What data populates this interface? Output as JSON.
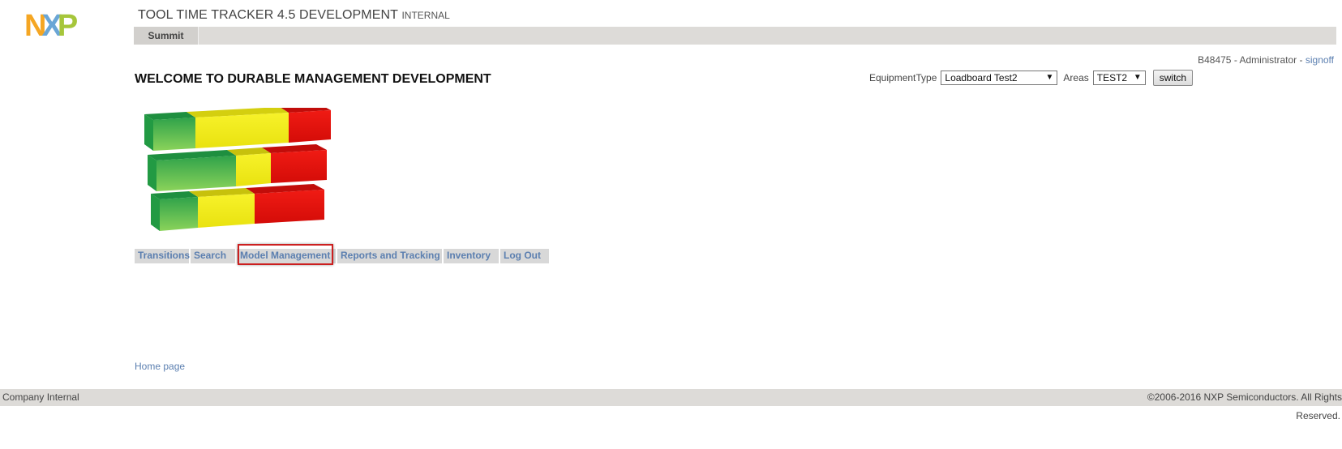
{
  "brand": {
    "logo_letters": [
      "N",
      "X",
      "P"
    ],
    "colors": {
      "n": "#f5a623",
      "x": "#6aa6d6",
      "p": "#a6c63b"
    }
  },
  "header": {
    "title": "TOOL TIME TRACKER 4.5 DEVELOPMENT",
    "title_suffix": "INTERNAL",
    "tabs": [
      {
        "label": "Summit"
      }
    ]
  },
  "user": {
    "info": "B48475 - Administrator -",
    "signoff_label": "signoff"
  },
  "welcome": "WELCOME TO DURABLE MANAGEMENT DEVELOPMENT",
  "equipment": {
    "type_label": "EquipmentType",
    "type_value": "Loadboard Test2",
    "areas_label": "Areas",
    "areas_value": "TEST2",
    "switch_label": "switch"
  },
  "banner": {
    "icon": "traffic-bars-graphic",
    "colors": {
      "green": "#5cbf4a",
      "yellow": "#f2ee1c",
      "red": "#e8130f"
    }
  },
  "menu": {
    "items": [
      {
        "label": "Transitions"
      },
      {
        "label": "Search"
      },
      {
        "label": "Model Management"
      },
      {
        "label": "Reports and Tracking"
      },
      {
        "label": "Inventory"
      },
      {
        "label": "Log Out"
      }
    ],
    "highlighted": "Model Management",
    "highlight_color": "#cc1f1f"
  },
  "home_link": "Home page",
  "footer": {
    "left": "Company Internal",
    "right": "©2006-2016 NXP Semiconductors. All Rights",
    "right_line2": "Reserved."
  }
}
